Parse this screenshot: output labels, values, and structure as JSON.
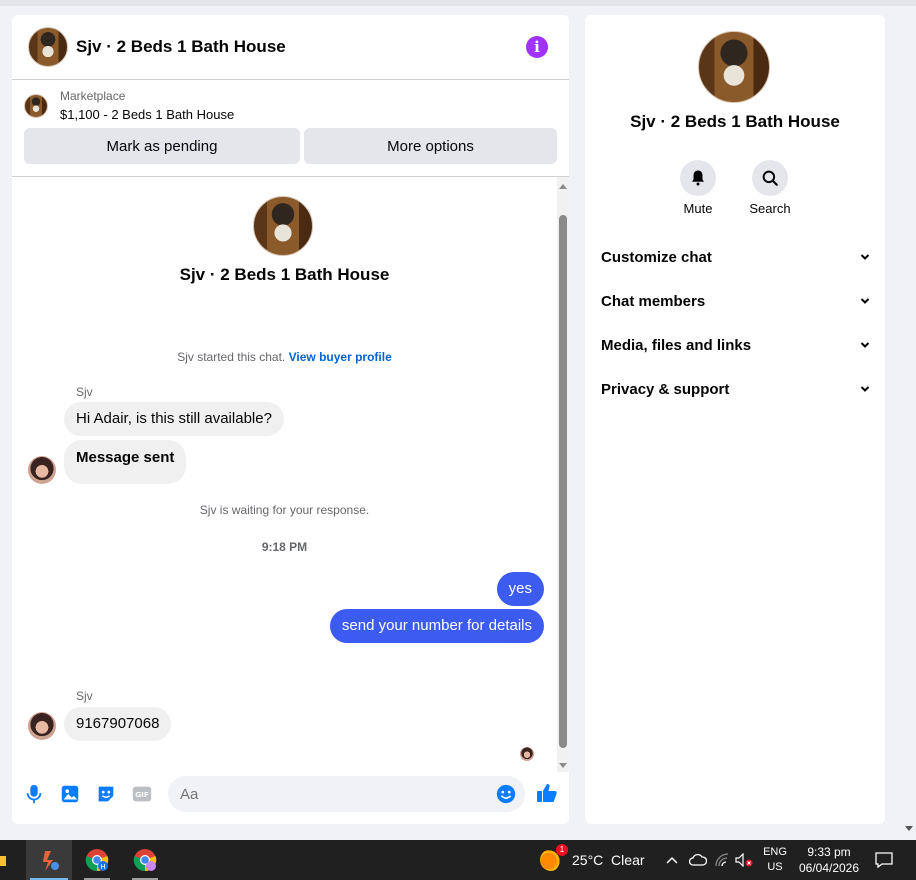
{
  "chat": {
    "title": "Sjv · 2 Beds 1 Bath House",
    "listing": {
      "label": "Marketplace",
      "summary": "$1,100 - 2 Beds 1 Bath House"
    },
    "buttons": {
      "pending": "Mark as pending",
      "more": "More options"
    },
    "thread_title": "Sjv · 2 Beds 1 Bath House",
    "started_text": "Sjv started this chat.",
    "buyer_link": "View buyer profile",
    "messages": [
      {
        "sender": "Sjv",
        "text": "Hi Adair, is this still available?",
        "direction": "in"
      },
      {
        "text": "Message sent",
        "direction": "in"
      },
      {
        "system": "Sjv is waiting for your response."
      },
      {
        "timestamp": "9:18 PM"
      },
      {
        "text": "yes",
        "direction": "out"
      },
      {
        "text": "send your number for details",
        "direction": "out"
      },
      {
        "sender": "Sjv",
        "text": "9167907068",
        "direction": "in"
      }
    ],
    "composer_placeholder": "Aa"
  },
  "info_panel": {
    "title": "Sjv · 2 Beds 1 Bath House",
    "actions": [
      {
        "label": "Mute",
        "icon": "bell-icon"
      },
      {
        "label": "Search",
        "icon": "search-icon"
      }
    ],
    "sections": [
      "Customize chat",
      "Chat members",
      "Media, files and links",
      "Privacy & support"
    ]
  },
  "taskbar": {
    "weather": "25°C  Clear",
    "weather_badge": "1",
    "lang_top": "ENG",
    "lang_bottom": "US",
    "time": "9:33 pm",
    "date": "06/04/2026",
    "chrome_badge_h": "H"
  },
  "colors": {
    "accent": "#3c5ded",
    "info_icon": "#a033ff",
    "link": "#0064d1",
    "composer_icons": "#0a7cff"
  }
}
